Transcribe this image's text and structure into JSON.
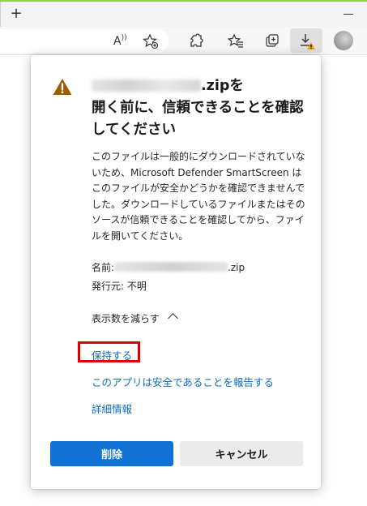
{
  "browser": {
    "new_tab_glyph": "+",
    "read_aloud_glyph": "A",
    "icons": [
      "read-aloud-icon",
      "add-favorite-icon",
      "extensions-icon",
      "favorites-icon",
      "collections-icon",
      "downloads-warning-icon",
      "profile-avatar"
    ]
  },
  "dialog": {
    "title_suffix": ".zipを",
    "title_rest": "開く前に、信頼できることを確認してください",
    "description": "このファイルは一般的にダウンロードされていないため、Microsoft Defender SmartScreen はこのファイルが安全かどうかを確認できませんでした。ダウンロードしているファイルまたはそのソースが信頼できることを確認してから、ファイルを開いてください。",
    "name_label": "名前:",
    "name_ext": ".zip",
    "publisher_label": "発行元:",
    "publisher_value": "不明",
    "show_less": "表示数を減らす",
    "keep_link": "保持する",
    "report_link": "このアプリは安全であることを報告する",
    "more_info_link": "詳細情報",
    "delete_button": "削除",
    "cancel_button": "キャンセル"
  },
  "colors": {
    "accent": "#1172d4",
    "link": "#0f6cbd",
    "warning": "#9c5d00",
    "highlight": "#e00000"
  }
}
